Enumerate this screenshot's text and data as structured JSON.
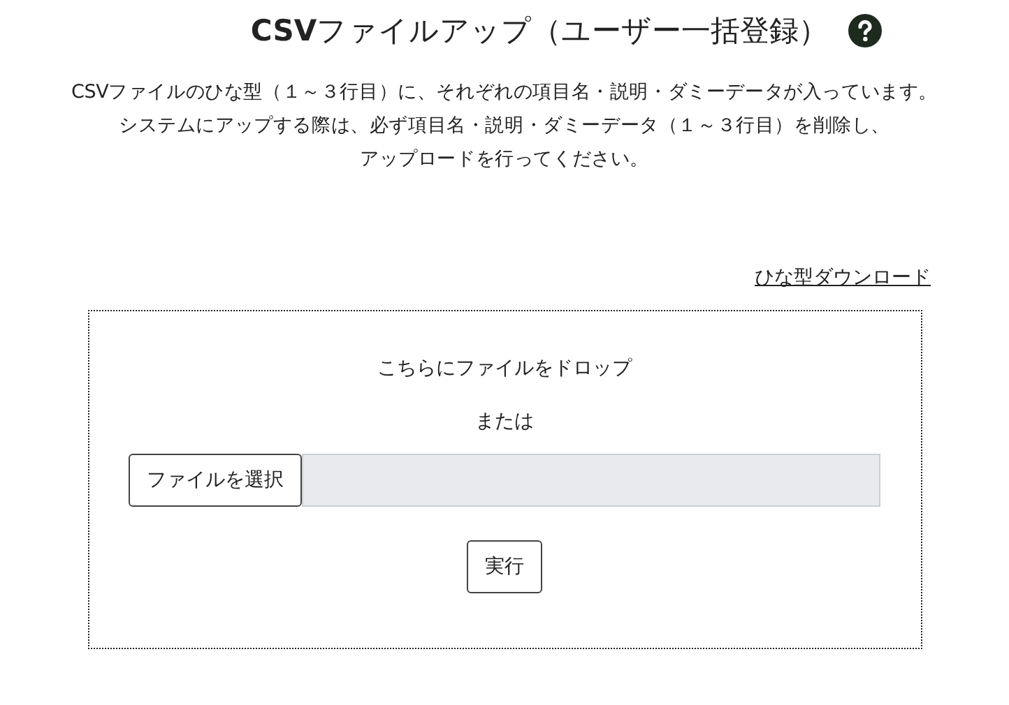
{
  "title": "**CSV**ファイルアップ（ユーザー一括登録）",
  "description": [
    "CSVファイルのひな型（１～３行目）に、それぞれの項目名・説明・ダミーデータが入っています。",
    "システムにアップする際は、必ず項目名・説明・ダミーデータ（１～３行目）を削除し、",
    "アップロードを行ってください。"
  ],
  "template_link": "ひな型ダウンロード",
  "dropzone": {
    "prompt": "こちらにファイルをドロップ",
    "or": "または",
    "file_button": "ファイルを選択",
    "submit": "実行"
  }
}
